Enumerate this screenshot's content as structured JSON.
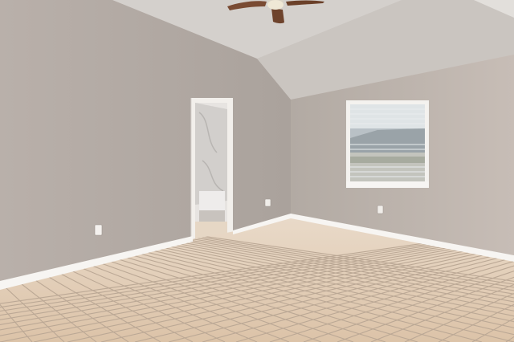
{
  "scene": {
    "alt": "",
    "colors": {
      "left_wall": "#b7aea8",
      "right_wall": "#c2b8b1",
      "back_wall": "#a9a19b",
      "ceiling_left": "#d8d4d0",
      "ceiling_right": "#cbc6c1",
      "floor": "#e2cdb5",
      "grout": "#b4a08c",
      "baseboard": "#f7f5f2",
      "door_trim": "#f2efeb",
      "window_frame": "#f4f2ef",
      "glass_sky": "#dfe4e6",
      "fan_blade": "#7a4b33"
    },
    "icons": [
      "ceiling-fan-icon",
      "outlet-icon",
      "window-icon",
      "doorway-icon"
    ]
  }
}
